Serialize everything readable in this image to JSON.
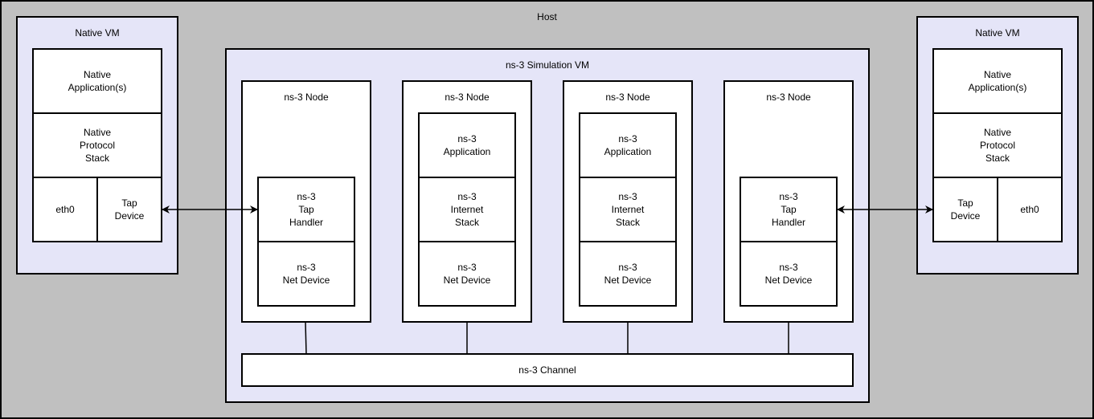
{
  "host": {
    "title": "Host"
  },
  "native_vm_left": {
    "title": "Native VM",
    "applications": "Native\nApplication(s)",
    "protocol_stack": "Native\nProtocol\nStack",
    "eth0": "eth0",
    "tap_device": "Tap\nDevice"
  },
  "native_vm_right": {
    "title": "Native VM",
    "applications": "Native\nApplication(s)",
    "protocol_stack": "Native\nProtocol\nStack",
    "tap_device": "Tap\nDevice",
    "eth0": "eth0"
  },
  "sim_vm": {
    "title": "ns-3 Simulation VM",
    "nodes": [
      {
        "title": "ns-3 Node",
        "upper": "ns-3\nTap\nHandler",
        "lower": "ns-3\nNet Device"
      },
      {
        "title": "ns-3 Node",
        "top": "ns-3\nApplication",
        "upper": "ns-3\nInternet\nStack",
        "lower": "ns-3\nNet Device"
      },
      {
        "title": "ns-3 Node",
        "top": "ns-3\nApplication",
        "upper": "ns-3\nInternet\nStack",
        "lower": "ns-3\nNet Device"
      },
      {
        "title": "ns-3 Node",
        "upper": "ns-3\nTap\nHandler",
        "lower": "ns-3\nNet Device"
      }
    ],
    "channel": "ns-3 Channel"
  },
  "colors": {
    "host": "#c0c0c0",
    "vm": "#e5e5f8",
    "box": "#ffffff",
    "stroke": "#000000"
  }
}
